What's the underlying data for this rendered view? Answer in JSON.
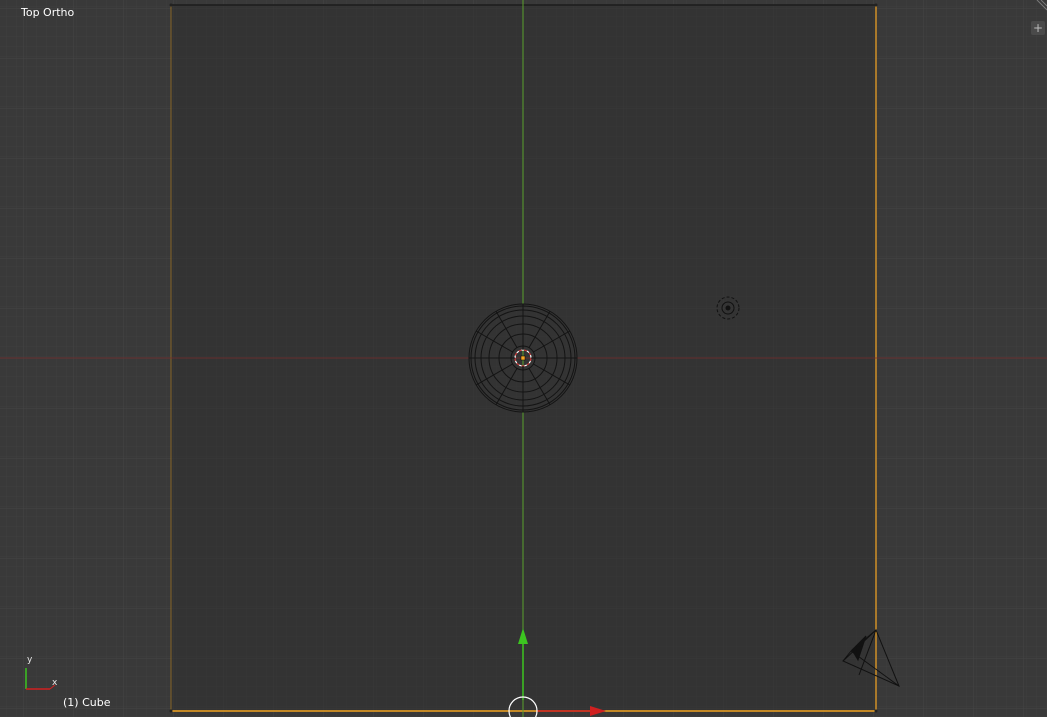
{
  "viewport": {
    "view_label": "Top Ortho",
    "object_info": "(1) Cube",
    "axis_widget": {
      "x_label": "x",
      "y_label": "y"
    },
    "icons": {
      "add": "plus-icon",
      "split": "area-split-icon",
      "camera": "camera-icon",
      "lamp": "lamp-icon",
      "cursor": "3d-cursor-icon",
      "mesh": "sphere-mesh-icon"
    },
    "colors": {
      "background": "#393939",
      "camera_frame": "#f5a623",
      "x_axis": "#8a2a2a",
      "y_axis": "#5aa02c",
      "manipulator_x": "#d02020",
      "manipulator_y": "#3cc420"
    }
  }
}
